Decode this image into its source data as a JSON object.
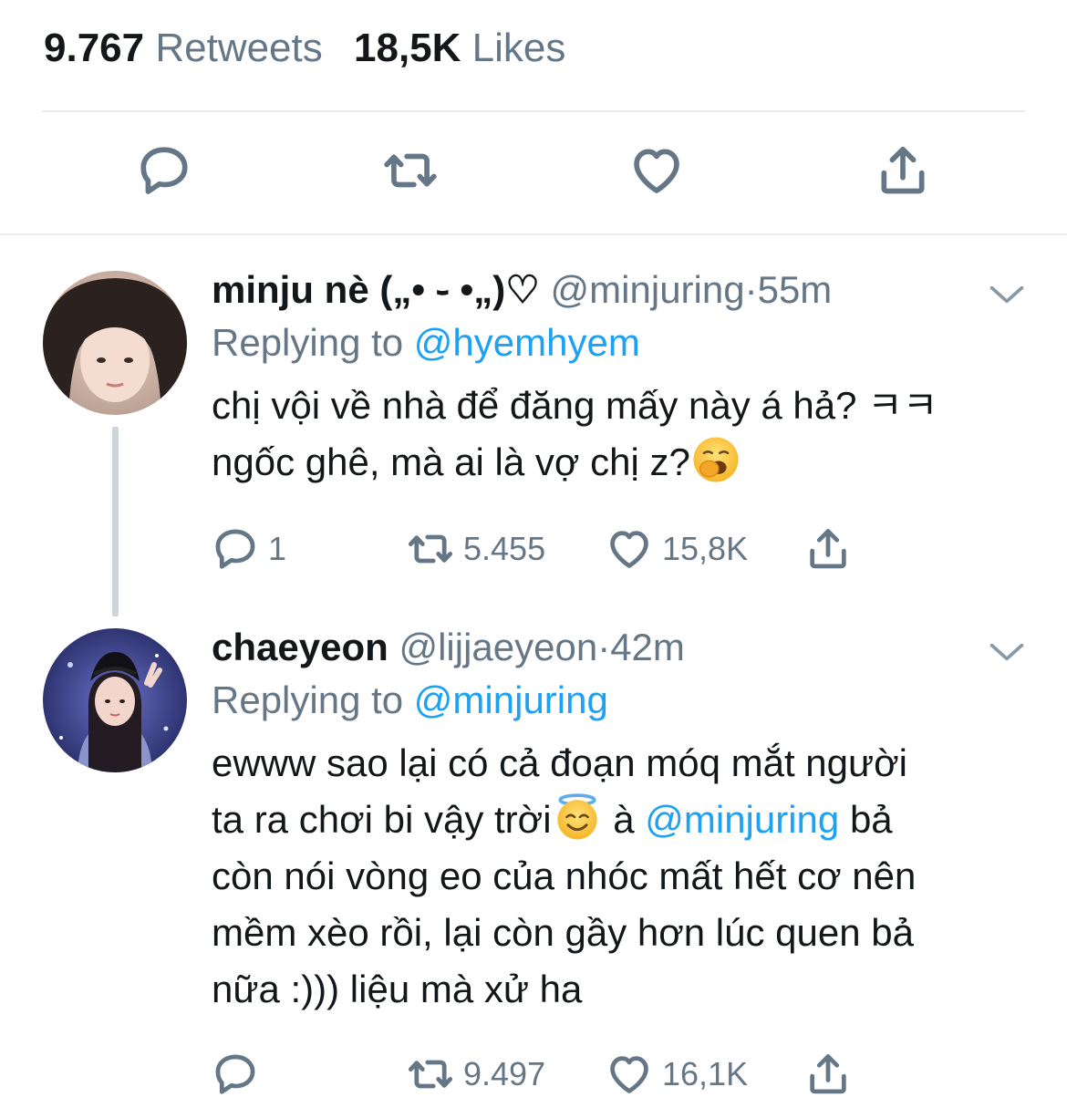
{
  "stats": {
    "retweets_count": "9.767",
    "retweets_label": "Retweets",
    "likes_count": "18,5K",
    "likes_label": "Likes"
  },
  "main_actions": [
    "reply-icon",
    "retweet-icon",
    "like-icon",
    "share-icon"
  ],
  "replies": [
    {
      "name": "minju nè („• ֊ •„)♡",
      "handle": "@minjuring",
      "separator": "·",
      "time": "55m",
      "replying_label": "Replying to",
      "replying_to": "@hyemhyem",
      "text_line1": "chị vội về nhà để đăng mấy này á hả? ㅋㅋ",
      "text_line2": "ngốc ghê, mà ai là vợ chị z?",
      "emoji": "yawning-face",
      "reply_count": "1",
      "retweet_count": "5.455",
      "like_count": "15,8K"
    },
    {
      "name": "chaeyeon",
      "handle": "@lijjaeyeon",
      "separator": "·",
      "time": "42m",
      "replying_label": "Replying to",
      "replying_to": "@minjuring",
      "text_line1": "ewww sao lại có cả đoạn móq mắt người",
      "text_line2a": "ta ra chơi bi vậy trời",
      "emoji": "smiling-face-with-halo",
      "text_line2b": " à ",
      "mention": "@minjuring",
      "text_line2c": " bả",
      "text_line3": "còn nói vòng eo của nhóc mất hết cơ nên",
      "text_line4": "mềm xèo rồi, lại còn gầy hơn lúc quen bả",
      "text_line5": "nữa :))) liệu mà xử ha",
      "reply_count": "",
      "retweet_count": "9.497",
      "like_count": "16,1K"
    }
  ],
  "colors": {
    "text": "#14171a",
    "secondary": "#657786",
    "link": "#1da1f2",
    "divider": "#e6ecf0",
    "thread_line": "#ccd6dd"
  }
}
